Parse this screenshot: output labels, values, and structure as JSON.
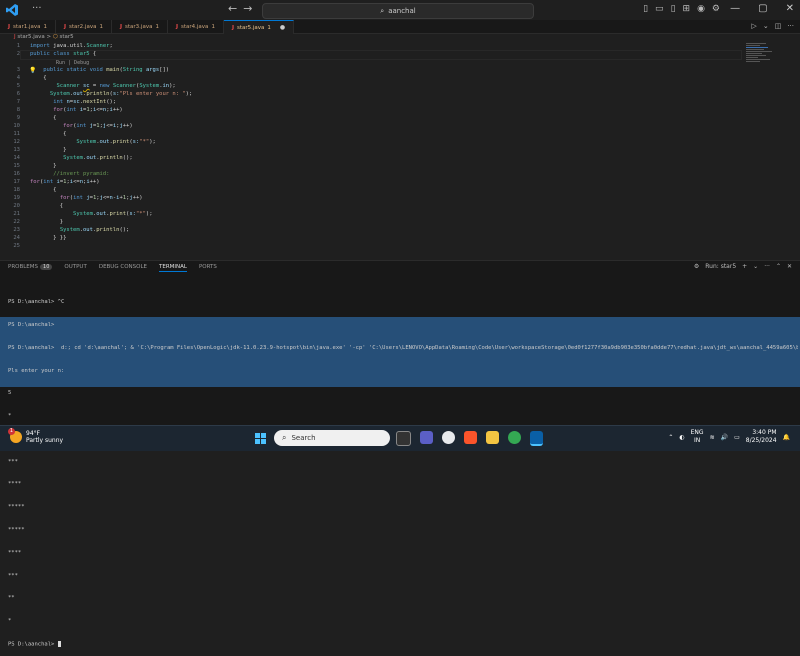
{
  "titlebar": {
    "search_text": "aanchal",
    "window_controls": [
      "—",
      "▢",
      "✕"
    ]
  },
  "tabs": [
    {
      "label": "star1.java",
      "badge": "1"
    },
    {
      "label": "star2.java",
      "badge": "1"
    },
    {
      "label": "star3.java",
      "badge": "1"
    },
    {
      "label": "star4.java",
      "badge": "1"
    },
    {
      "label": "star5.java",
      "badge": "1"
    }
  ],
  "breadcrumb": {
    "file": "star5.java",
    "symbol": "star5"
  },
  "editor": {
    "codelens": "Run | Debug",
    "line_numbers": [
      "1",
      "2",
      "3",
      "4",
      "5",
      "6",
      "7",
      "8",
      "9",
      "10",
      "11",
      "12",
      "13",
      "14",
      "15",
      "16",
      "17",
      "18",
      "19",
      "20",
      "21",
      "22",
      "23",
      "24",
      "25"
    ]
  },
  "panel": {
    "tabs": [
      {
        "label": "PROBLEMS",
        "badge": "10"
      },
      {
        "label": "OUTPUT"
      },
      {
        "label": "DEBUG CONSOLE"
      },
      {
        "label": "TERMINAL"
      },
      {
        "label": "PORTS"
      }
    ],
    "run_label": "Run: star5",
    "terminal_lines": [
      "PS D:\\aanchal> ^C",
      "PS D:\\aanchal>",
      "PS D:\\aanchal>  d:; cd 'd:\\aanchal'; & 'C:\\Program Files\\OpenLogic\\jdk-11.0.23.9-hotspot\\bin\\java.exe' '-cp' 'C:\\Users\\LENOVO\\AppData\\Roaming\\Code\\User\\workspaceStorage\\0ed0f1277f30a9db903e350bfa0dde77\\redhat.java\\jdt_ws\\aanchal_4459a605\\bin' 'star5'",
      "Pls enter your n:",
      "5",
      "*",
      "**",
      "***",
      "****",
      "*****",
      "*****",
      "****",
      "***",
      "**",
      "*",
      "PS D:\\aanchal> "
    ]
  },
  "taskbar": {
    "temperature": "94°F",
    "weather": "Partly sunny",
    "weather_badge": "1",
    "search_placeholder": "Search",
    "lang_top": "ENG",
    "lang_bottom": "IN",
    "time": "3:40 PM",
    "date": "8/25/2024"
  }
}
